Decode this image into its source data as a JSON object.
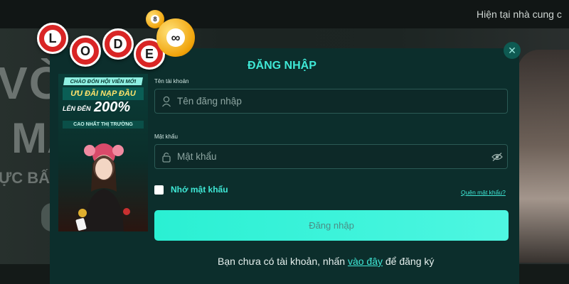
{
  "header": {
    "marquee_text": "Hiện tại nhà cung c"
  },
  "background": {
    "text1": "VÒN",
    "text2": "MA",
    "text3": "ỰC BẤM"
  },
  "logo": {
    "letters": [
      "L",
      "O",
      "D",
      "E"
    ],
    "ball_small": "8",
    "ball_big": "∞"
  },
  "modal": {
    "title": "ĐĂNG NHẬP",
    "close_symbol": "✕",
    "promo": {
      "line1": "CHÀO ĐÓN HỘI VIÊN MỚI",
      "line2": "ƯU ĐÃI NẠP ĐẦU",
      "line3_prefix": "LÊN ĐẾN",
      "line3_value": "200%",
      "line4": "CAO NHẤT THỊ TRƯỜNG"
    },
    "username": {
      "label": "Tên tài khoản",
      "placeholder": "Tên đăng nhập",
      "icon": "user-icon"
    },
    "password": {
      "label": "Mật khẩu",
      "placeholder": "Mật khẩu",
      "icon": "lock-icon",
      "toggle_icon": "eye-icon"
    },
    "remember_label": "Nhớ mật khẩu",
    "forgot_link": "Quên mật khẩu?",
    "submit_label": "Đăng nhập",
    "signup": {
      "prefix": "Bạn chưa có tài khoản, nhấn ",
      "link": "vào đây",
      "suffix": " để đăng ký"
    }
  },
  "colors": {
    "accent": "#3fe8d6",
    "modal_bg": "#0c2e2c",
    "button": "#2af0d3"
  }
}
